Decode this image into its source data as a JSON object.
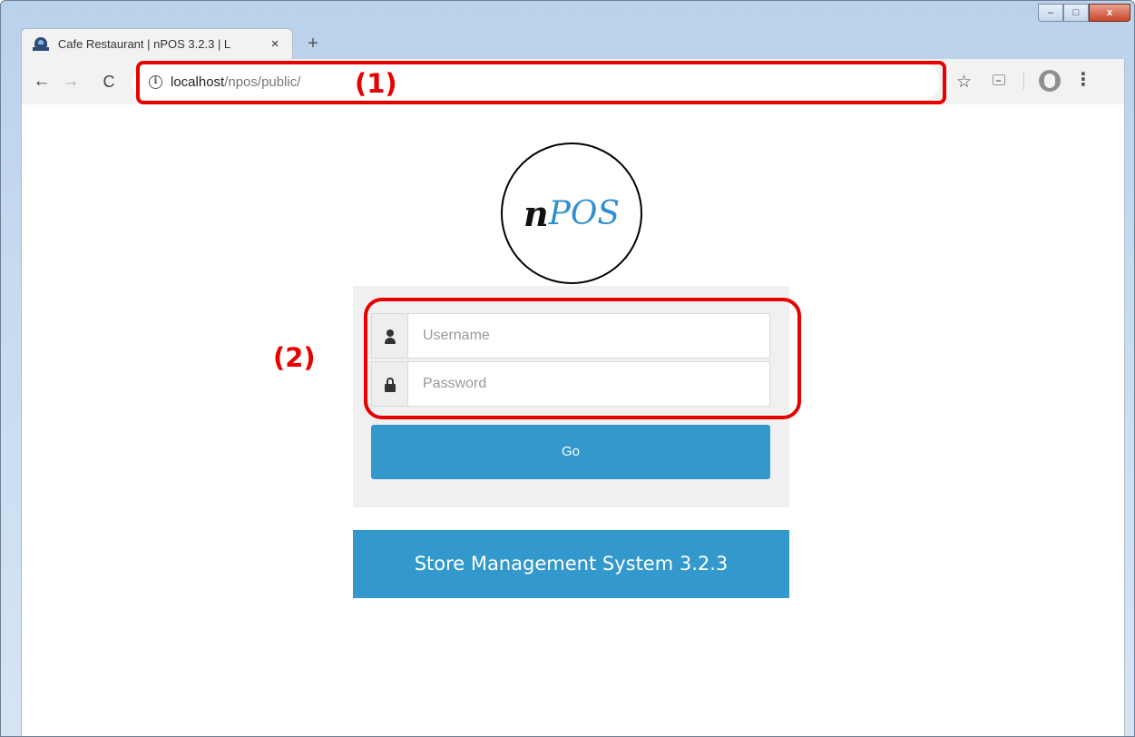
{
  "browser": {
    "tab_title": "Cafe Restaurant | nPOS 3.2.3 | L",
    "tab_close": "×",
    "new_tab": "+",
    "url_host": "localhost",
    "url_path": "/npos/public/",
    "info_glyph": "i",
    "star_glyph": "☆",
    "menu_glyph": "⋮",
    "back_glyph": "←",
    "forward_glyph": "→",
    "reload_glyph": "C",
    "window_controls": {
      "minimize": "–",
      "maximize": "□",
      "close": "x"
    }
  },
  "page": {
    "logo": {
      "n": "n",
      "pos": "POS"
    },
    "username_placeholder": "Username",
    "password_placeholder": "Password",
    "go_label": "Go",
    "banner": "Store Management System 3.2.3"
  },
  "annotations": {
    "label_1": "(1)",
    "label_2": "(2)",
    "color": "#e60000"
  },
  "colors": {
    "primary_blue": "#3398cc",
    "logo_blue": "#2f8fd0",
    "panel_gray": "#f0f0f0"
  }
}
